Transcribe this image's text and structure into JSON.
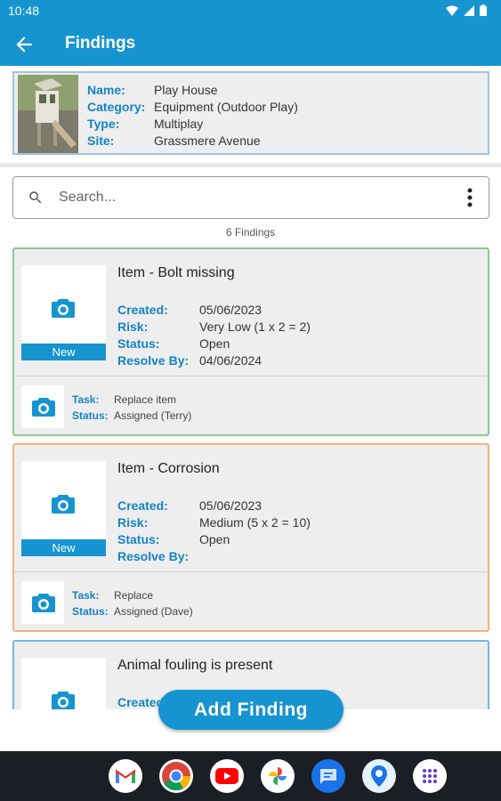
{
  "status_bar": {
    "time": "10:48"
  },
  "app_bar": {
    "title": "Findings"
  },
  "asset": {
    "rows": [
      {
        "label": "Name:",
        "value": "Play House"
      },
      {
        "label": "Category:",
        "value": "Equipment (Outdoor Play)"
      },
      {
        "label": "Type:",
        "value": "Multiplay"
      },
      {
        "label": "Site:",
        "value": "Grassmere Avenue"
      }
    ]
  },
  "search": {
    "placeholder": "Search..."
  },
  "findings_count": "6 Findings",
  "findings": [
    {
      "title": "Item - Bolt missing",
      "badge": "New",
      "border_color": "#8cc98f",
      "details": [
        {
          "label": "Created:",
          "value": "05/06/2023"
        },
        {
          "label": "Risk:",
          "value": "Very Low (1 x 2 = 2)"
        },
        {
          "label": "Status:",
          "value": "Open"
        },
        {
          "label": "Resolve By:",
          "value": "04/06/2024"
        }
      ],
      "task": [
        {
          "label": "Task:",
          "value": "Replace item"
        },
        {
          "label": "Status:",
          "value": "Assigned (Terry)"
        }
      ]
    },
    {
      "title": "Item - Corrosion",
      "badge": "New",
      "border_color": "#f4b37a",
      "details": [
        {
          "label": "Created:",
          "value": "05/06/2023"
        },
        {
          "label": "Risk:",
          "value": "Medium (5 x 2 = 10)"
        },
        {
          "label": "Status:",
          "value": "Open"
        },
        {
          "label": "Resolve By:",
          "value": ""
        }
      ],
      "task": [
        {
          "label": "Task:",
          "value": "Replace"
        },
        {
          "label": "Status:",
          "value": "Assigned (Dave)"
        }
      ]
    },
    {
      "title": "Animal fouling is present",
      "border_color": "#7ab4e0",
      "details": [
        {
          "label": "Created:",
          "value": ""
        }
      ]
    }
  ],
  "fab": {
    "label": "Add Finding"
  },
  "dock": [
    "gmail-icon",
    "chrome-icon",
    "youtube-icon",
    "photos-icon",
    "messages-icon",
    "maps-icon",
    "app-drawer-icon"
  ],
  "colors": {
    "primary": "#1694d0",
    "label": "#1583c4",
    "card_bg": "#eeeeee"
  }
}
